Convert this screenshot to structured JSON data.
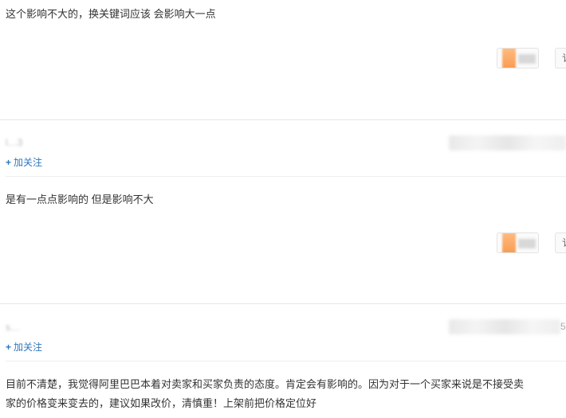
{
  "answers": [
    {
      "text": "这个影响不大的，换关键词应该 会影响大一点",
      "side_button": "讠"
    },
    {
      "user": "l…3",
      "follow_label": "加关注",
      "text": "是有一点点影响的  但是影响不大",
      "side_button": "讠"
    },
    {
      "user": "s…",
      "date_tail": "5",
      "follow_label": "加关注",
      "text_lines": [
        "目前不清楚，我觉得阿里巴巴本着对卖家和买家负责的态度。肯定会有影响的。因为对于一个买家来说是不接受卖",
        "家的价格变来变去的，建议如果改价，清慎重！上架前把价格定位好"
      ]
    }
  ],
  "icons": {
    "follow": "plus-icon"
  },
  "colors": {
    "link": "#2f77bd",
    "text": "#333333",
    "divider": "#dfe8ee",
    "reaction_accent": "#f89a4f"
  }
}
